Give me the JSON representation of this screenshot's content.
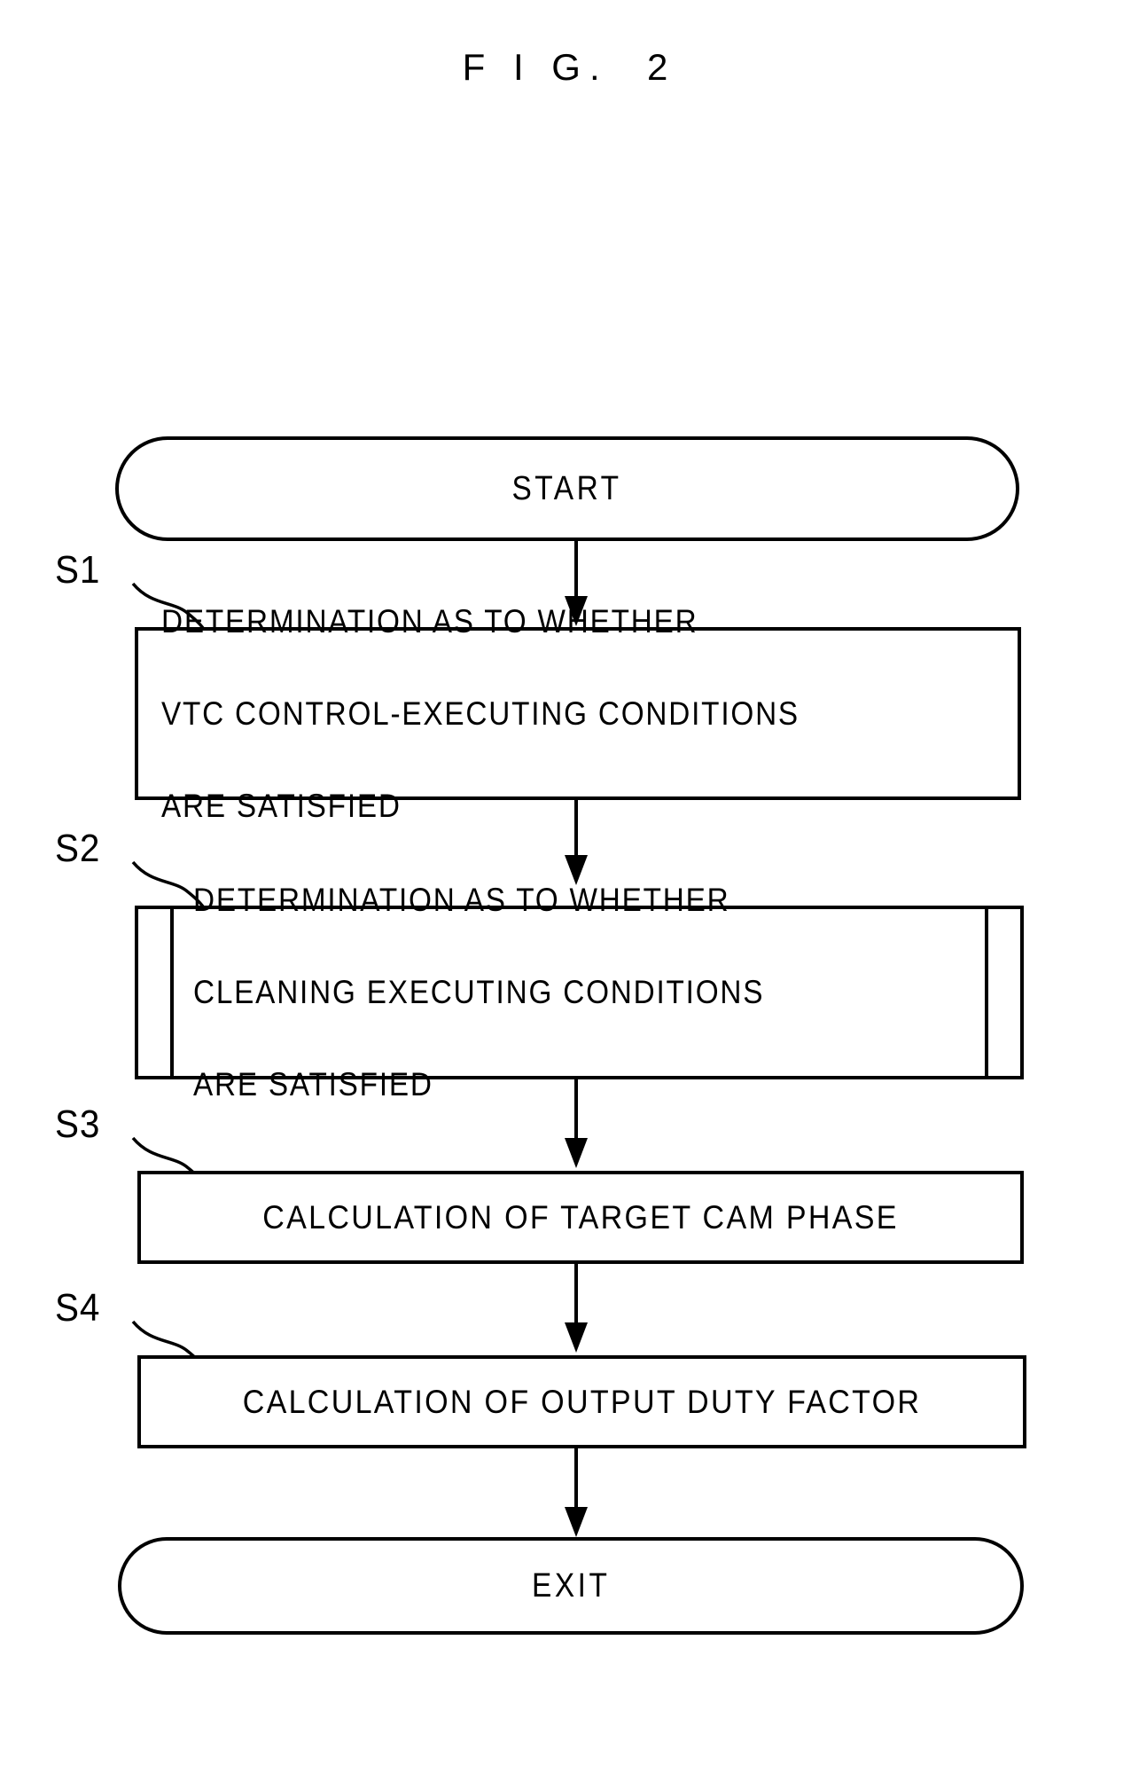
{
  "figure": {
    "title": "F I G.  2"
  },
  "flowchart": {
    "type": "flowchart",
    "orientation": "top-to-bottom",
    "nodes": [
      {
        "id": "start",
        "shape": "terminal",
        "label": "START"
      },
      {
        "id": "s1",
        "shape": "process",
        "step": "S1",
        "label": "DETERMINATION AS TO WHETHER\nVTC CONTROL-EXECUTING CONDITIONS\nARE SATISFIED",
        "lines": [
          "DETERMINATION AS TO WHETHER",
          "VTC CONTROL-EXECUTING CONDITIONS",
          "ARE SATISFIED"
        ]
      },
      {
        "id": "s2",
        "shape": "predefined-process",
        "step": "S2",
        "label": "DETERMINATION AS TO WHETHER\nCLEANING EXECUTING CONDITIONS\nARE SATISFIED",
        "lines": [
          "DETERMINATION AS TO WHETHER",
          "CLEANING EXECUTING CONDITIONS",
          "ARE SATISFIED"
        ]
      },
      {
        "id": "s3",
        "shape": "process",
        "step": "S3",
        "label": "CALCULATION OF TARGET CAM PHASE",
        "lines": [
          "CALCULATION OF TARGET CAM PHASE"
        ]
      },
      {
        "id": "s4",
        "shape": "process",
        "step": "S4",
        "label": "CALCULATION OF OUTPUT DUTY FACTOR",
        "lines": [
          "CALCULATION OF OUTPUT DUTY FACTOR"
        ]
      },
      {
        "id": "exit",
        "shape": "terminal",
        "label": "EXIT"
      }
    ],
    "edges": [
      {
        "from": "start",
        "to": "s1"
      },
      {
        "from": "s1",
        "to": "s2"
      },
      {
        "from": "s2",
        "to": "s3"
      },
      {
        "from": "s3",
        "to": "s4"
      },
      {
        "from": "s4",
        "to": "exit"
      }
    ],
    "step_labels": [
      "S1",
      "S2",
      "S3",
      "S4"
    ],
    "colors": {
      "stroke": "#000000",
      "fill": "#ffffff",
      "text": "#000000"
    }
  }
}
